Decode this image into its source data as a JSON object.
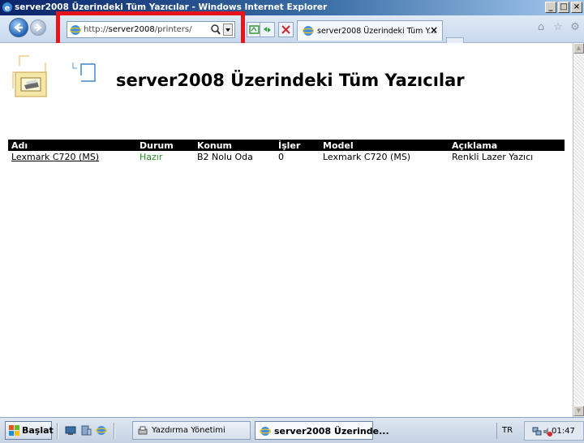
{
  "window": {
    "title": "server2008 Üzerindeki Tüm Yazıcılar - Windows Internet Explorer",
    "controls": [
      "_",
      "□",
      "×"
    ]
  },
  "browser": {
    "address_prefix": "http://",
    "address_host": "server2008",
    "address_path": "/printers/",
    "tab_title": "server2008 Üzerindeki Tüm Y...",
    "tab_close": "×",
    "icons": [
      "back-arrow-icon",
      "forward-arrow-icon",
      "ie-page-icon",
      "search-icon",
      "dropdown-icon",
      "compat-view-icon",
      "refresh-icon",
      "stop-icon",
      "home-icon",
      "favorites-star-icon",
      "tools-gear-icon"
    ]
  },
  "page": {
    "title": "server2008 Üzerindeki Tüm Yazıcılar",
    "columns": [
      "Adı",
      "Durum",
      "Konum",
      "İşler",
      "Model",
      "Açıklama"
    ],
    "rows": [
      {
        "name": "Lexmark C720 (MS)",
        "status": "Hazır",
        "location": "B2 Nolu Oda",
        "jobs": "0",
        "model": "Lexmark C720 (MS)",
        "description": "Renkli Lazer Yazıcı"
      }
    ],
    "status_color": "#2a8a2a",
    "header_bg": "#000000",
    "logo_icon": "printer-folder-icon"
  },
  "taskbar": {
    "start_label": "Başlat",
    "quick_launch": [
      "show-desktop-icon",
      "server-manager-icon",
      "ie-quicklaunch-icon"
    ],
    "buttons": [
      {
        "label": "Yazdırma Yönetimi",
        "icon": "print-management-icon",
        "active": false
      },
      {
        "label": "server2008 Üzerinde...",
        "icon": "ie-taskbar-icon",
        "active": true
      }
    ],
    "language": "TR",
    "clock": "01:47"
  },
  "accent": {
    "highlight_border": "#e8141c",
    "titlebar": "#0a246a"
  }
}
